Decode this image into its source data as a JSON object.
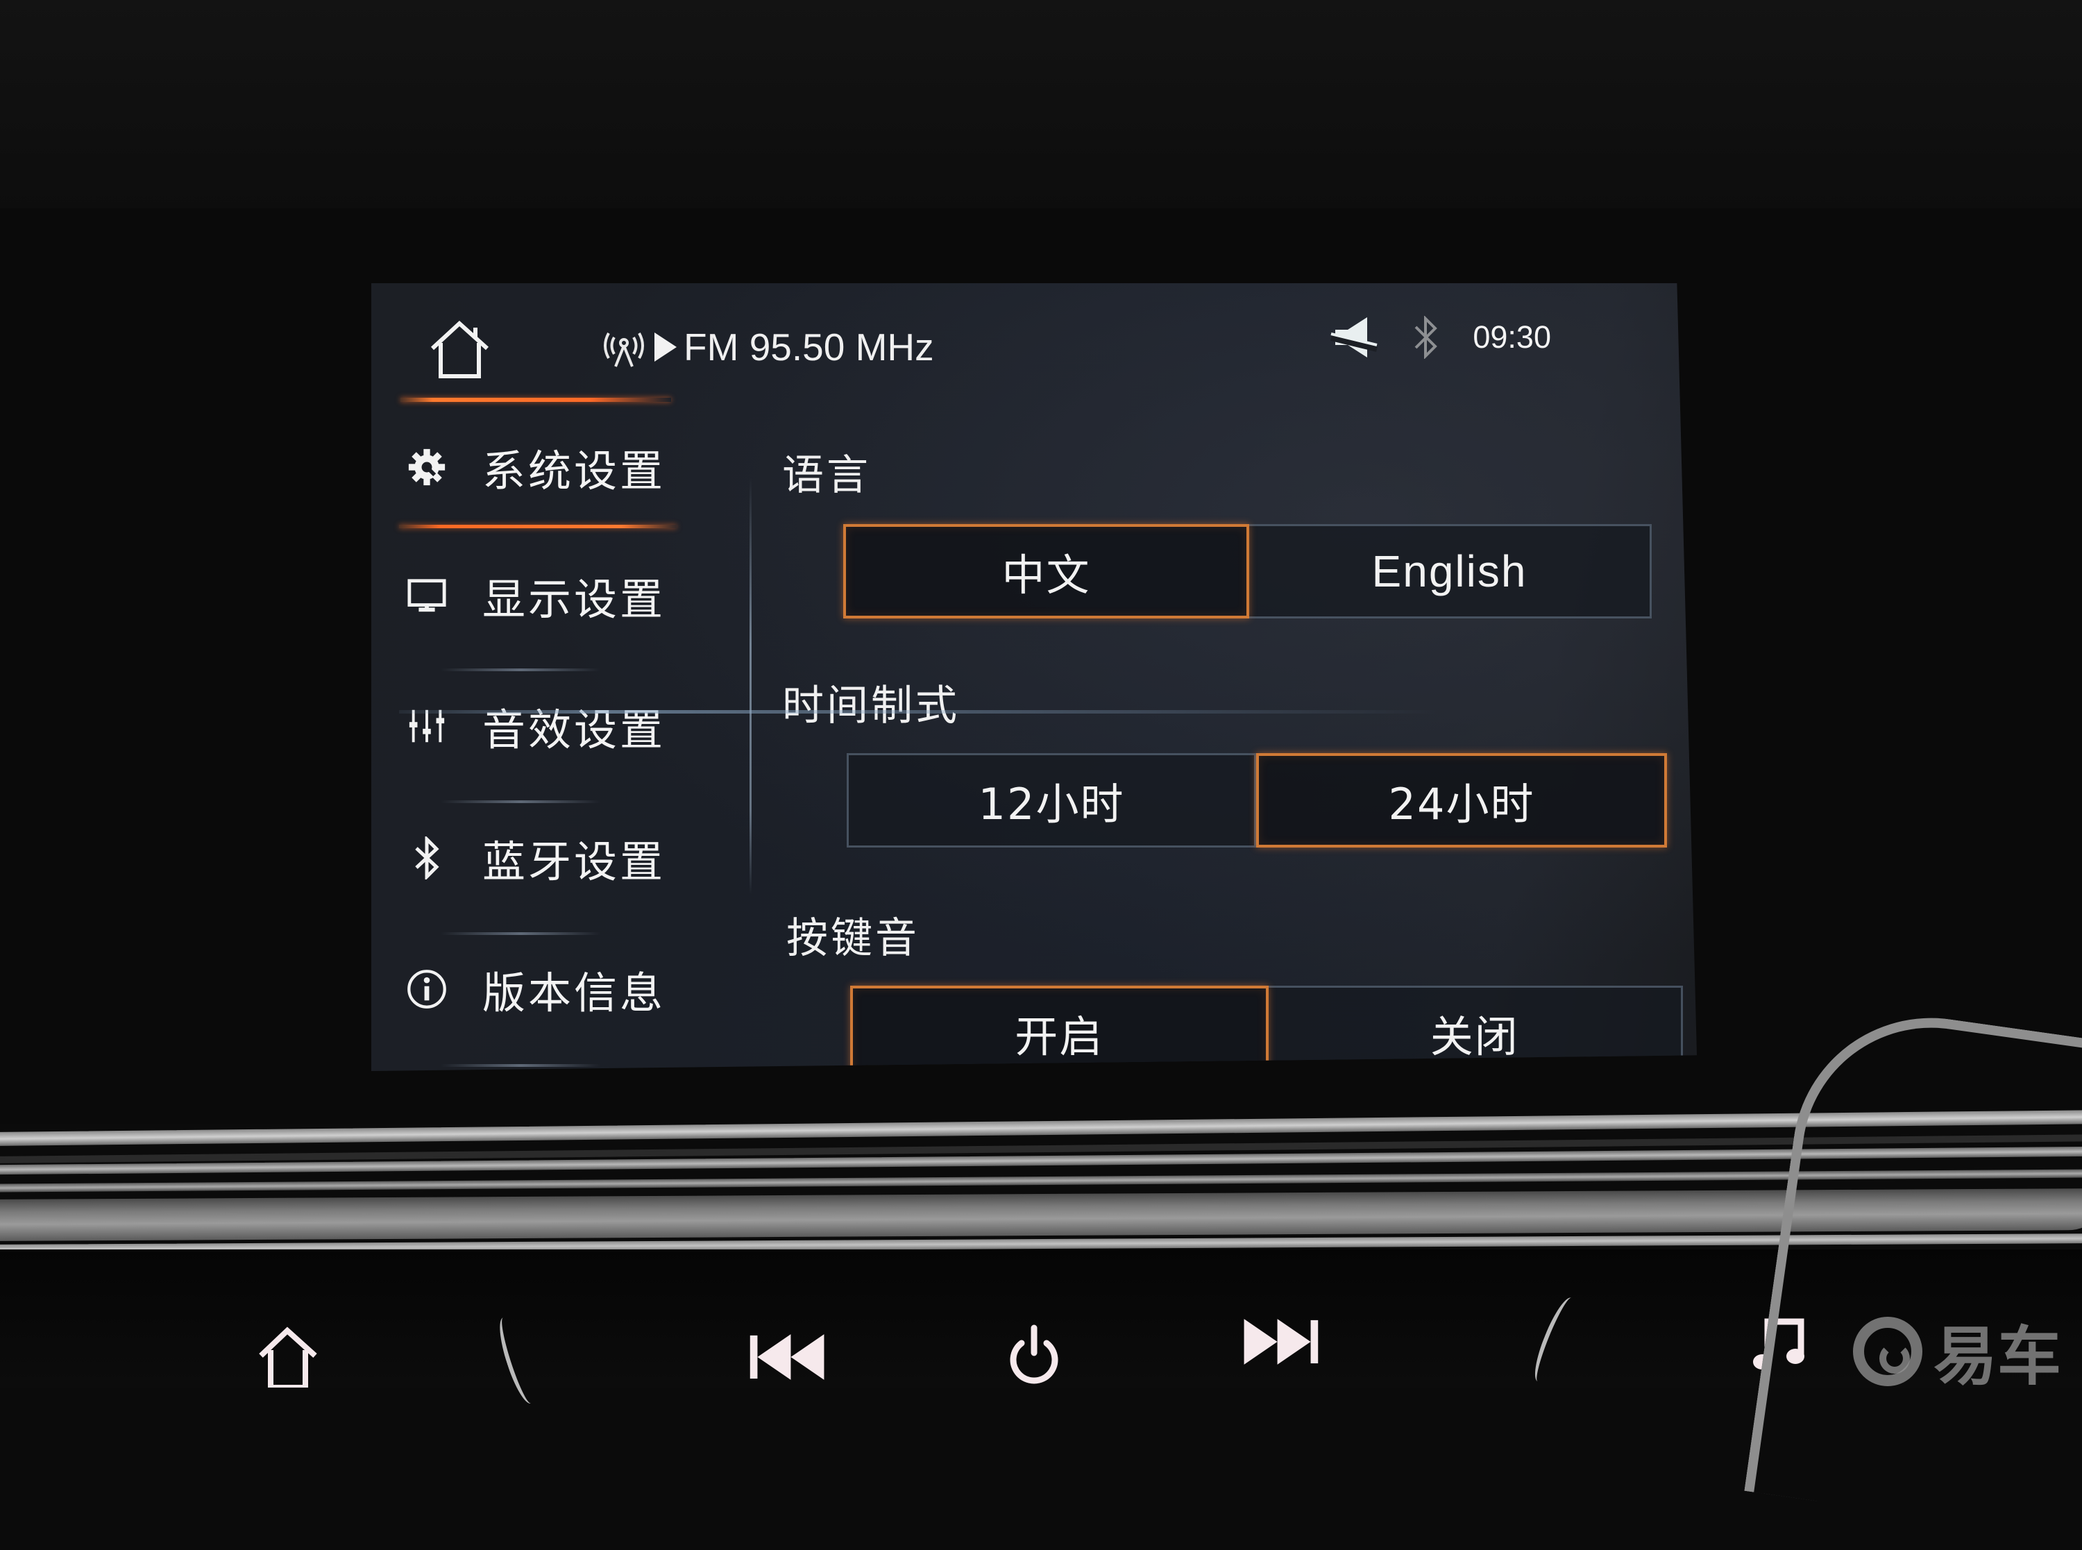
{
  "status_bar": {
    "home_icon": "home-icon",
    "radio_icon": "radio-broadcast-icon",
    "play_icon": "play-icon",
    "radio_text": "FM 95.50 MHz",
    "mute_icon": "speaker-muted-icon",
    "bluetooth_icon": "bluetooth-icon",
    "clock": "09:30"
  },
  "sidebar": {
    "items": [
      {
        "label": "系统设置",
        "icon": "gear-wrench-icon",
        "active": true
      },
      {
        "label": "显示设置",
        "icon": "monitor-icon",
        "active": false
      },
      {
        "label": "音效设置",
        "icon": "equalizer-icon",
        "active": false
      },
      {
        "label": "蓝牙设置",
        "icon": "bluetooth-icon",
        "active": false
      },
      {
        "label": "版本信息",
        "icon": "info-icon",
        "active": false
      }
    ]
  },
  "settings": {
    "language": {
      "label": "语言",
      "options": [
        "中文",
        "English"
      ],
      "selected": "中文"
    },
    "time_format": {
      "label": "时间制式",
      "options": [
        "12小时",
        "24小时"
      ],
      "selected": "24小时"
    },
    "key_tone": {
      "label": "按键音",
      "options": [
        "开启",
        "关闭"
      ],
      "selected": "开启"
    }
  },
  "physical_buttons": [
    {
      "name": "home",
      "icon": "home-icon"
    },
    {
      "name": "previous-track",
      "icon": "skip-previous-icon"
    },
    {
      "name": "power",
      "icon": "power-icon"
    },
    {
      "name": "next-track",
      "icon": "skip-next-icon"
    },
    {
      "name": "music",
      "icon": "music-note-icon"
    }
  ],
  "watermark": {
    "text": "易车"
  }
}
